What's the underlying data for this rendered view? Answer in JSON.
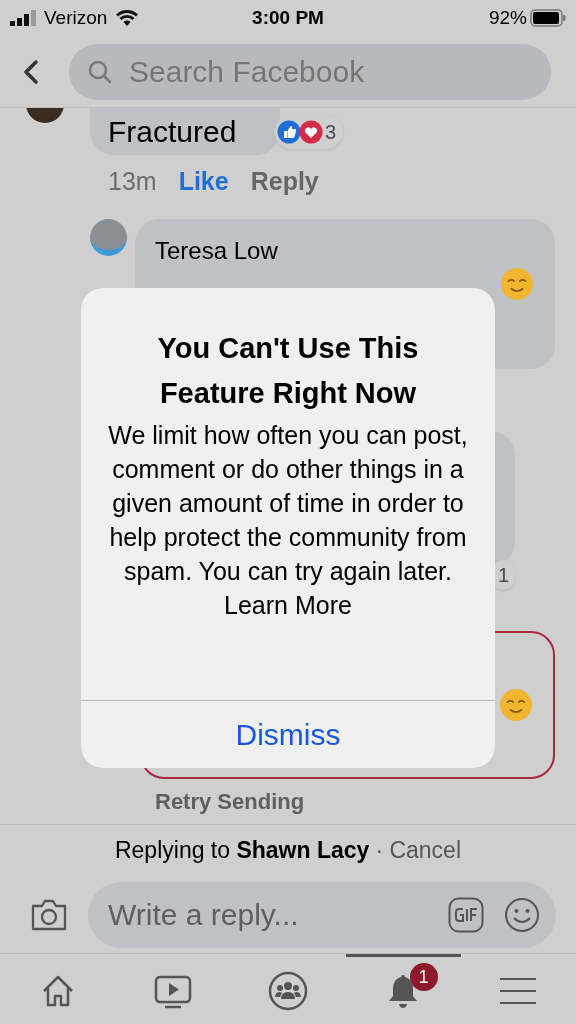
{
  "status_bar": {
    "carrier": "Verizon",
    "time": "3:00 PM",
    "battery": "92%"
  },
  "search": {
    "placeholder": "Search Facebook"
  },
  "comments": [
    {
      "kind": "top",
      "text": "Fractured",
      "reactions": "3",
      "time": "13m",
      "like": "Like",
      "liked": true,
      "reply": "Reply"
    },
    {
      "kind": "reply",
      "author": "Teresa Low"
    },
    {
      "kind": "hidden",
      "reactions": "1"
    },
    {
      "kind": "failed",
      "retry": "Retry Sending"
    }
  ],
  "alert": {
    "title": "You Can't Use This Feature Right Now",
    "message": "We limit how often you can post, comment or do other things in a given amount of time in order to help protect the community from spam. You can try again later.",
    "link": "Learn More",
    "button": "Dismiss"
  },
  "composer": {
    "replying_to": "Replying to **Shawn Lacy**",
    "cancel": "· Cancel",
    "placeholder": "Write a reply..."
  },
  "tab_bar": [
    {
      "kind": "home",
      "selected": false
    },
    {
      "kind": "video",
      "selected": false
    },
    {
      "kind": "groups",
      "selected": false
    },
    {
      "kind": "notifications",
      "selected": true,
      "badge": "1"
    },
    {
      "kind": "menu",
      "selected": false
    }
  ]
}
